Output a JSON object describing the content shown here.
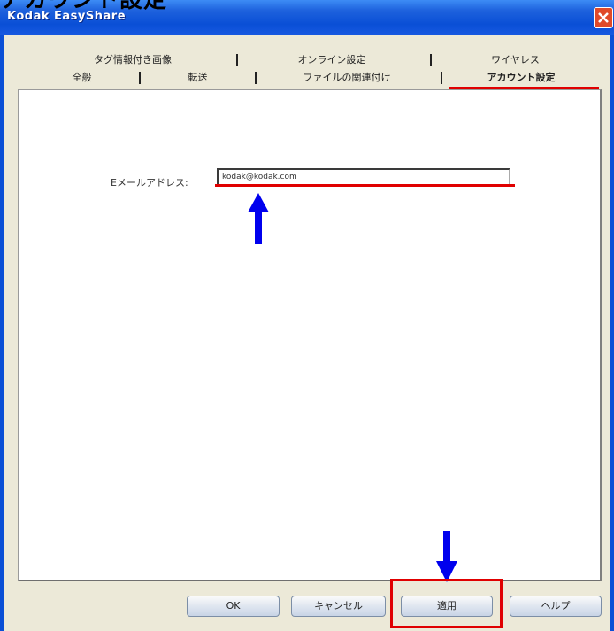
{
  "clipped_heading": "アカウント設定",
  "window": {
    "title": "Kodak EasyShare"
  },
  "tabs": {
    "row1": [
      {
        "label": "タグ情報付き画像"
      },
      {
        "label": "オンライン設定"
      },
      {
        "label": "ワイヤレス"
      }
    ],
    "row2": [
      {
        "label": "全般"
      },
      {
        "label": "転送"
      },
      {
        "label": "ファイルの関連付け"
      },
      {
        "label": "アカウント設定"
      }
    ]
  },
  "account": {
    "email_label": "Eメールアドレス:",
    "email_value": "kodak@kodak.com"
  },
  "buttons": {
    "ok": "OK",
    "cancel": "キャンセル",
    "apply": "適用",
    "help": "ヘルプ"
  },
  "colors": {
    "highlight": "#e00000",
    "arrow": "#0000ee",
    "titlebar": "#0a4fd6"
  }
}
